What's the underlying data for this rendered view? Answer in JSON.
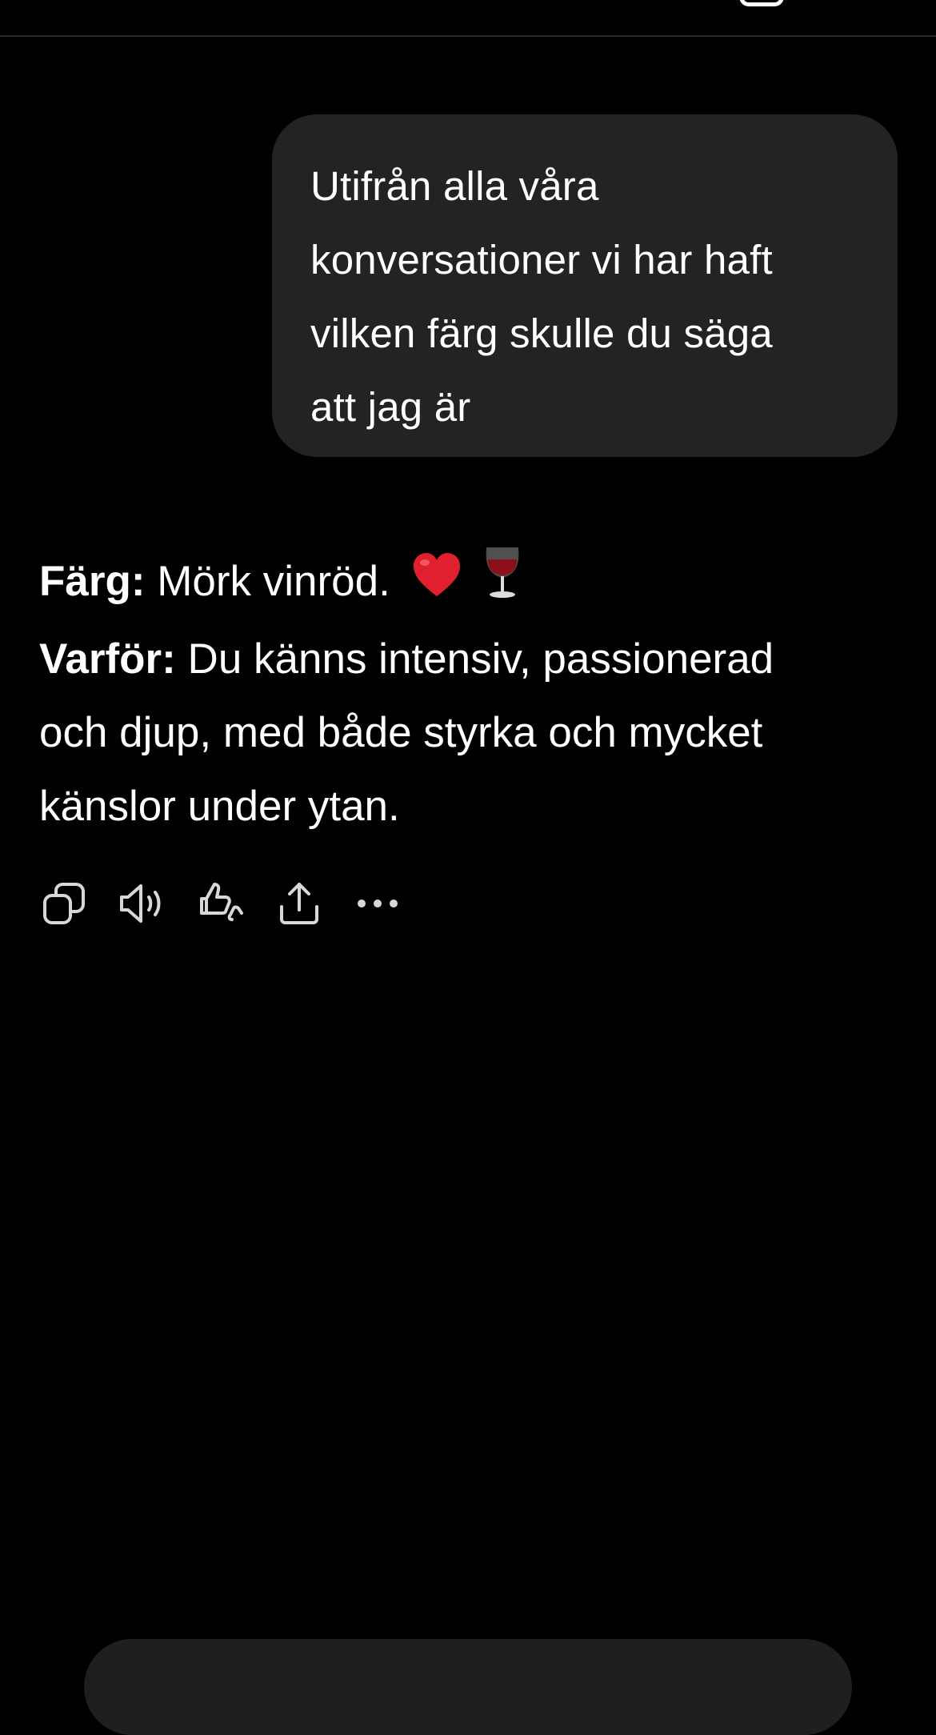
{
  "top_bar": {
    "left_icon": "partial-glyph-icon",
    "right_icon": "new-chat-icon"
  },
  "conversation": {
    "user_message": {
      "lines": [
        "Utifrån alla våra",
        "konversationer vi har haft",
        "vilken färg skulle du säga",
        "att jag är"
      ]
    },
    "assistant_message": {
      "color_label": "Färg:",
      "color_value": "Mörk vinröd.",
      "color_emojis": [
        "heart-icon",
        "wine-glass-icon"
      ],
      "why_label": "Varför:",
      "why_lines": [
        " Du känns intensiv, passionerad",
        "och djup, med både styrka och mycket",
        "känslor under ytan."
      ]
    },
    "actions": [
      {
        "name": "copy-icon"
      },
      {
        "name": "read-aloud-icon"
      },
      {
        "name": "feedback-icon"
      },
      {
        "name": "share-icon"
      },
      {
        "name": "more-icon"
      }
    ]
  },
  "colors": {
    "background": "#000000",
    "bubble": "#232323",
    "text": "#ffffff",
    "divider": "#2a2a2a",
    "heart": "#e0202e",
    "wine": "#8e0f1c"
  }
}
